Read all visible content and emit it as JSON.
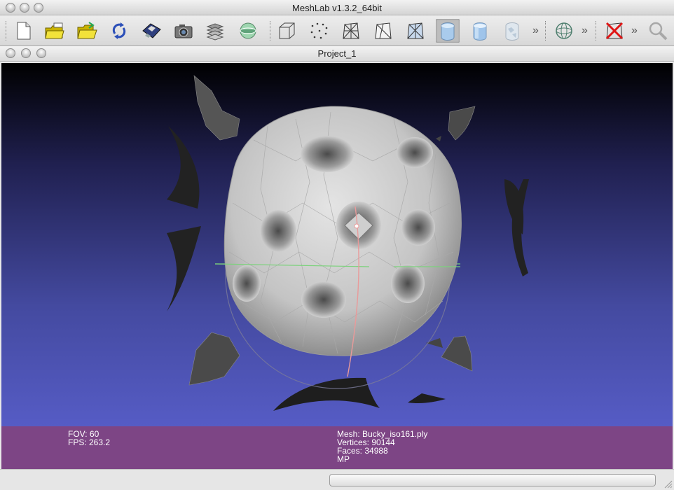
{
  "window": {
    "title": "MeshLab v1.3.2_64bit"
  },
  "toolbar": {
    "buttons": [
      {
        "name": "new-project",
        "icon": "new-file-icon"
      },
      {
        "name": "open-project",
        "icon": "folder-stack-icon"
      },
      {
        "name": "import-mesh",
        "icon": "open-folder-icon"
      },
      {
        "name": "reload",
        "icon": "reload-arrows-icon"
      },
      {
        "name": "save",
        "icon": "floppy-disk-icon"
      },
      {
        "name": "snapshot",
        "icon": "camera-icon"
      },
      {
        "name": "layers",
        "icon": "layers-icon"
      },
      {
        "name": "raster",
        "icon": "globe-image-icon"
      },
      {
        "name": "bounding-box",
        "icon": "box-wire-icon"
      },
      {
        "name": "points",
        "icon": "points-icon"
      },
      {
        "name": "wireframe",
        "icon": "wireframe-icon"
      },
      {
        "name": "hidden-lines",
        "icon": "hidden-lines-icon"
      },
      {
        "name": "flat-lines",
        "icon": "flat-lines-icon"
      },
      {
        "name": "flat",
        "icon": "flat-shaded-icon"
      },
      {
        "name": "smooth",
        "icon": "smooth-shaded-icon"
      },
      {
        "name": "texture",
        "icon": "texture-icon"
      },
      {
        "name": "trackball",
        "icon": "trackball-icon"
      },
      {
        "name": "delete",
        "icon": "red-x-icon"
      },
      {
        "name": "search",
        "icon": "magnifier-icon"
      }
    ],
    "more_glyph": "»"
  },
  "document": {
    "title": "Project_1"
  },
  "viewport": {
    "fov_label": "FOV: 60",
    "fps_label": "FPS:   263.2",
    "mesh_label": "Mesh: Bucky_iso161.ply",
    "vertices_label": "Vertices: 90144",
    "faces_label": "Faces: 34988",
    "mode_label": "MP"
  },
  "colors": {
    "info_bar": "#7d4585",
    "background_top": "#000000",
    "background_bottom": "#5c62d2",
    "mesh": "#c8c8c8"
  }
}
